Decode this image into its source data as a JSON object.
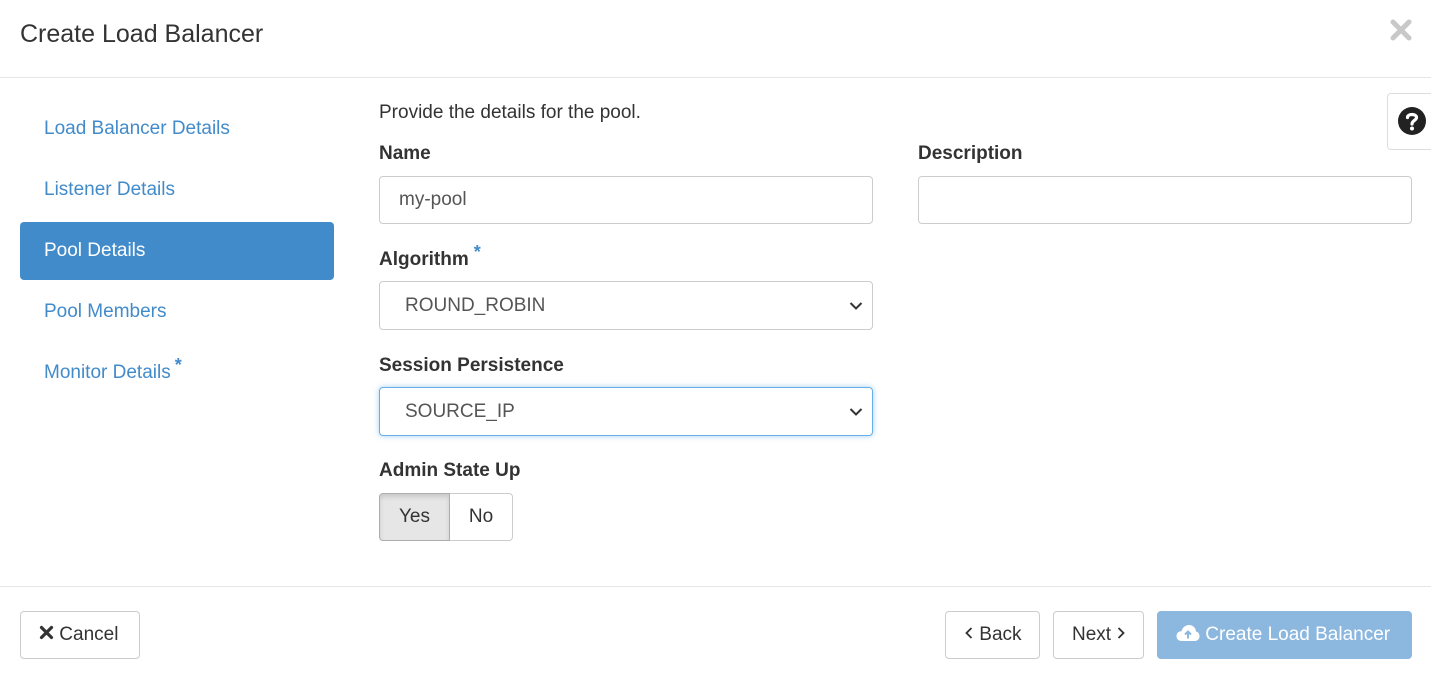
{
  "dialog": {
    "title": "Create Load Balancer"
  },
  "nav": {
    "items": [
      {
        "label": "Load Balancer Details",
        "active": false,
        "required": false
      },
      {
        "label": "Listener Details",
        "active": false,
        "required": false
      },
      {
        "label": "Pool Details",
        "active": true,
        "required": false
      },
      {
        "label": "Pool Members",
        "active": false,
        "required": false
      },
      {
        "label": "Monitor Details",
        "active": false,
        "required": true
      }
    ],
    "required_marker": "*"
  },
  "form": {
    "intro": "Provide the details for the pool.",
    "name": {
      "label": "Name",
      "value": "my-pool"
    },
    "description": {
      "label": "Description",
      "value": ""
    },
    "algorithm": {
      "label": "Algorithm",
      "required_marker": "*",
      "value": "ROUND_ROBIN"
    },
    "session_persistence": {
      "label": "Session Persistence",
      "value": "SOURCE_IP"
    },
    "admin_state_up": {
      "label": "Admin State Up",
      "options": [
        "Yes",
        "No"
      ],
      "selected": "Yes"
    }
  },
  "footer": {
    "cancel_label": "Cancel",
    "back_label": "Back",
    "next_label": "Next",
    "create_label": "Create Load Balancer"
  },
  "colors": {
    "accent": "#428bca",
    "primary_disabled": "#8cb7df",
    "focus": "#66afe9"
  },
  "icons": [
    "close-icon",
    "question-circle-icon",
    "chevron-down-icon",
    "times-icon",
    "chevron-left-icon",
    "chevron-right-icon",
    "cloud-upload-icon"
  ]
}
